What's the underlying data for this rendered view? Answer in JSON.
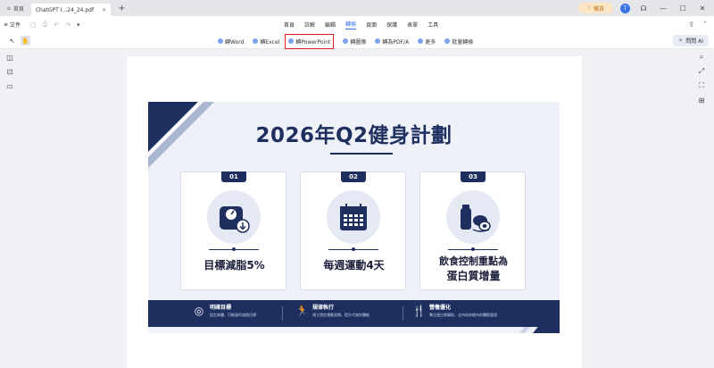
{
  "tabs": [
    {
      "label": "首頁",
      "icon": "home-icon"
    },
    {
      "label": "ChatGPT I...24_24.pdf",
      "icon": "pdf-icon"
    }
  ],
  "header": {
    "upgrade_label": "暢貨",
    "avatar_letter": "T"
  },
  "menu": {
    "file_label": "文件",
    "items": [
      "首頁",
      "註解",
      "編輯",
      "轉換",
      "頁面",
      "保護",
      "表單",
      "工具"
    ],
    "active": "轉換"
  },
  "toolbar": {
    "items": [
      {
        "label": "轉Word",
        "highlighted": false
      },
      {
        "label": "轉Excel",
        "highlighted": false
      },
      {
        "label": "轉PowerPoint",
        "highlighted": true
      },
      {
        "label": "轉圖像",
        "highlighted": false
      },
      {
        "label": "轉為PDF/A",
        "highlighted": false
      },
      {
        "label": "更多",
        "highlighted": false
      },
      {
        "label": "批量轉換",
        "highlighted": false
      }
    ],
    "ai_label": "問問 AI",
    "highlight_color": "#e02020"
  },
  "slide": {
    "title": "2026年Q2健身計劃",
    "cards": [
      {
        "num": "01",
        "label": "目標減脂5%",
        "icon": "scale-icon"
      },
      {
        "num": "02",
        "label": "每週運動4天",
        "icon": "calendar-icon"
      },
      {
        "num": "03",
        "label_line1": "飲食控制重點為",
        "label_line2": "蛋白質增量",
        "icon": "food-icon"
      }
    ],
    "banner": [
      {
        "title": "明確目標",
        "desc": "設定具體、可衡量的減脂目標",
        "icon": "target-icon"
      },
      {
        "title": "規律執行",
        "desc": "建立穩定運動習慣，提升代謝與體能",
        "icon": "runner-icon"
      },
      {
        "title": "營養優化",
        "desc": "專注蛋白質攝取，支持肌肉維持與體脂管理",
        "icon": "dining-icon"
      }
    ],
    "colors": {
      "navy": "#1d2e5f",
      "background": "#eef1f7"
    }
  }
}
